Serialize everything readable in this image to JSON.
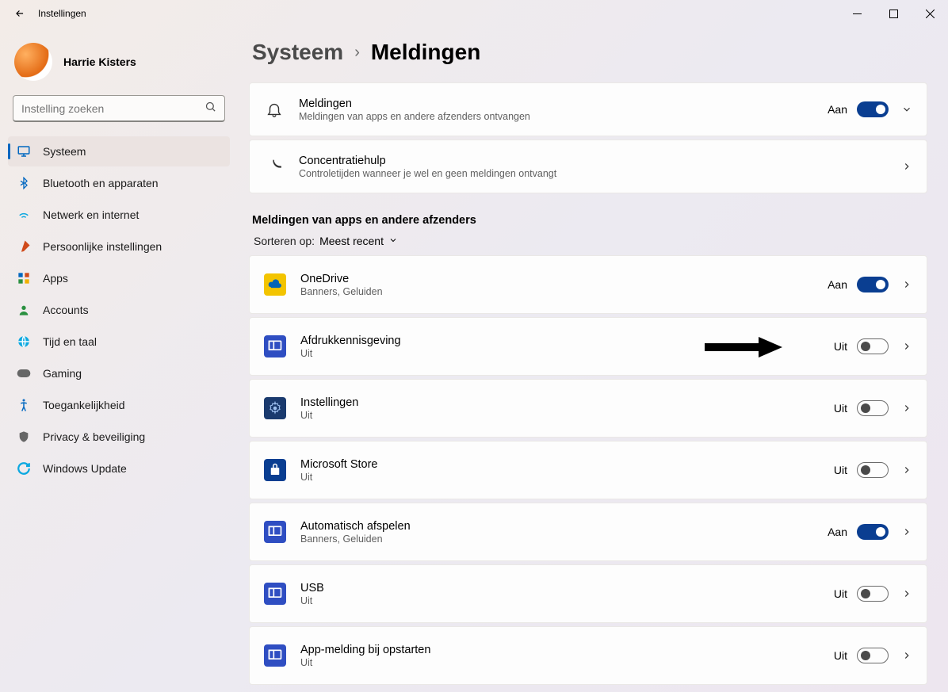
{
  "window": {
    "title": "Instellingen"
  },
  "profile": {
    "name": "Harrie Kisters"
  },
  "search": {
    "placeholder": "Instelling zoeken"
  },
  "nav": {
    "items": [
      {
        "label": "Systeem",
        "selected": true,
        "icon": "display"
      },
      {
        "label": "Bluetooth en apparaten",
        "icon": "bluetooth"
      },
      {
        "label": "Netwerk en internet",
        "icon": "wifi"
      },
      {
        "label": "Persoonlijke instellingen",
        "icon": "brush"
      },
      {
        "label": "Apps",
        "icon": "apps"
      },
      {
        "label": "Accounts",
        "icon": "person"
      },
      {
        "label": "Tijd en taal",
        "icon": "globe"
      },
      {
        "label": "Gaming",
        "icon": "gamepad"
      },
      {
        "label": "Toegankelijkheid",
        "icon": "accessibility"
      },
      {
        "label": "Privacy & beveiliging",
        "icon": "shield"
      },
      {
        "label": "Windows Update",
        "icon": "update"
      }
    ]
  },
  "breadcrumb": {
    "parent": "Systeem",
    "current": "Meldingen"
  },
  "header_cards": [
    {
      "title": "Meldingen",
      "sub": "Meldingen van apps en andere afzenders ontvangen",
      "state_label": "Aan",
      "toggle_on": true,
      "expand": "down",
      "icon": "bell"
    },
    {
      "title": "Concentratiehulp",
      "sub": "Controletijden wanneer je wel en geen meldingen ontvangt",
      "state_label": "",
      "toggle_on": null,
      "expand": "right",
      "icon": "moon"
    }
  ],
  "section_title": "Meldingen van apps en andere afzenders",
  "sort_label": "Sorteren op:",
  "sort_value": "Meest recent",
  "apps": [
    {
      "title": "OneDrive",
      "sub": "Banners, Geluiden",
      "state_label": "Aan",
      "toggle_on": true,
      "icon": "onedrive",
      "arrow": false
    },
    {
      "title": "Afdrukkennisgeving",
      "sub": "Uit",
      "state_label": "Uit",
      "toggle_on": false,
      "icon": "generic",
      "arrow": true
    },
    {
      "title": "Instellingen",
      "sub": "Uit",
      "state_label": "Uit",
      "toggle_on": false,
      "icon": "settings",
      "arrow": false
    },
    {
      "title": "Microsoft Store",
      "sub": "Uit",
      "state_label": "Uit",
      "toggle_on": false,
      "icon": "store",
      "arrow": false
    },
    {
      "title": "Automatisch afspelen",
      "sub": "Banners, Geluiden",
      "state_label": "Aan",
      "toggle_on": true,
      "icon": "generic",
      "arrow": false
    },
    {
      "title": "USB",
      "sub": "Uit",
      "state_label": "Uit",
      "toggle_on": false,
      "icon": "generic",
      "arrow": false
    },
    {
      "title": "App-melding bij opstarten",
      "sub": "Uit",
      "state_label": "Uit",
      "toggle_on": false,
      "icon": "generic",
      "arrow": false
    }
  ]
}
